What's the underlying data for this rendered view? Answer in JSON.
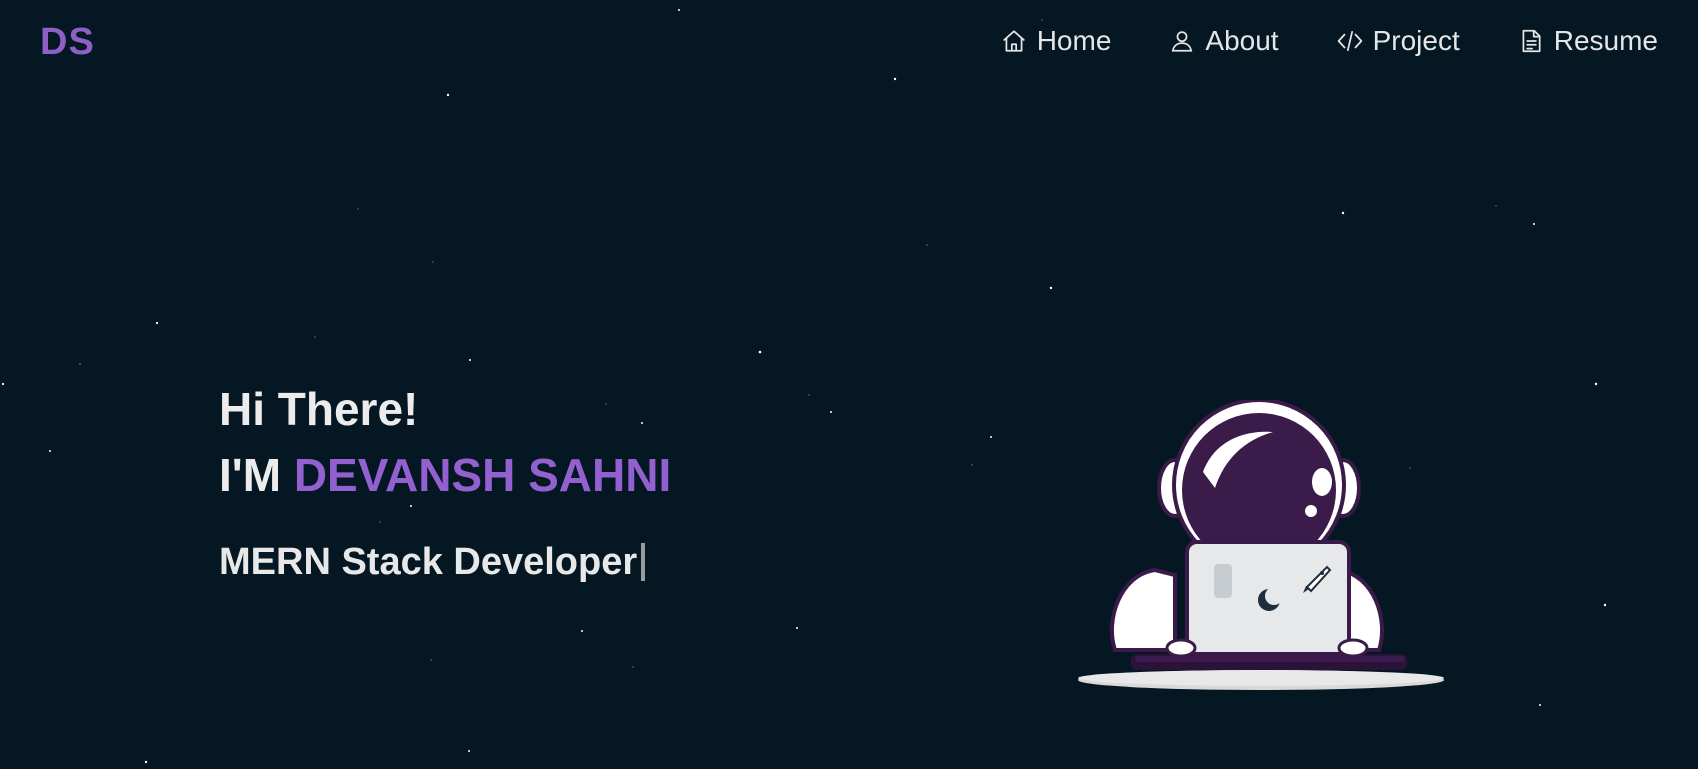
{
  "logo": {
    "text": "DS"
  },
  "nav": {
    "items": [
      {
        "label": "Home",
        "icon": "home-icon"
      },
      {
        "label": "About",
        "icon": "user-icon"
      },
      {
        "label": "Project",
        "icon": "code-icon"
      },
      {
        "label": "Resume",
        "icon": "document-icon"
      }
    ]
  },
  "hero": {
    "greeting": "Hi There!",
    "intro_prefix": "I'M",
    "name": "DEVANSH SAHNI",
    "role": "MERN Stack Developer"
  },
  "illustration": {
    "subject": "astronaut-with-laptop"
  },
  "colors": {
    "background": "#041723",
    "accent": "#9361cf",
    "text": "#ececec"
  }
}
